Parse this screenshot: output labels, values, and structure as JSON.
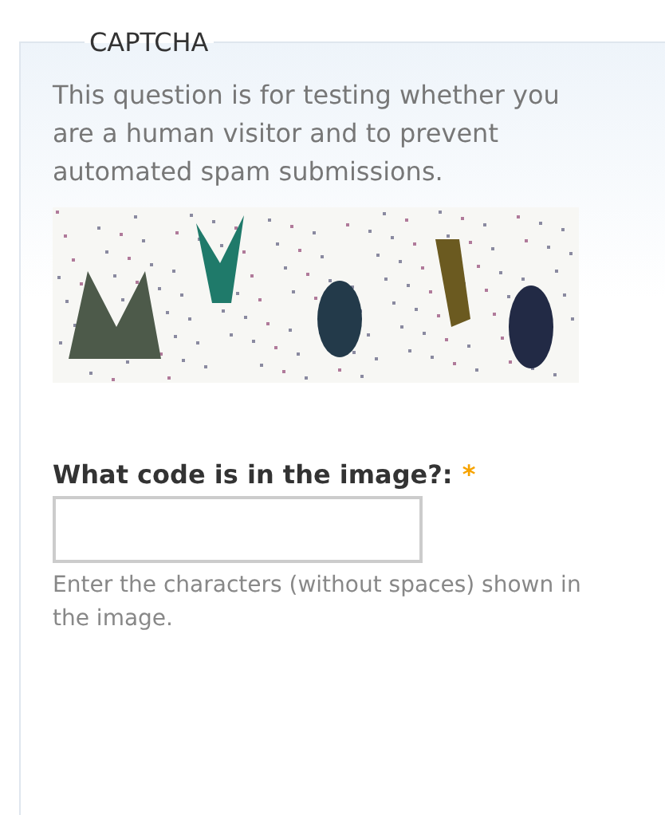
{
  "fieldset": {
    "legend": "CAPTCHA",
    "description": "This question is for testing whether you are a human visitor and to prevent automated spam submissions.",
    "field": {
      "label": "What code is in the image?:",
      "required_mark": "*",
      "required": true,
      "help": "Enter the characters (without spaces) shown in the image."
    }
  }
}
